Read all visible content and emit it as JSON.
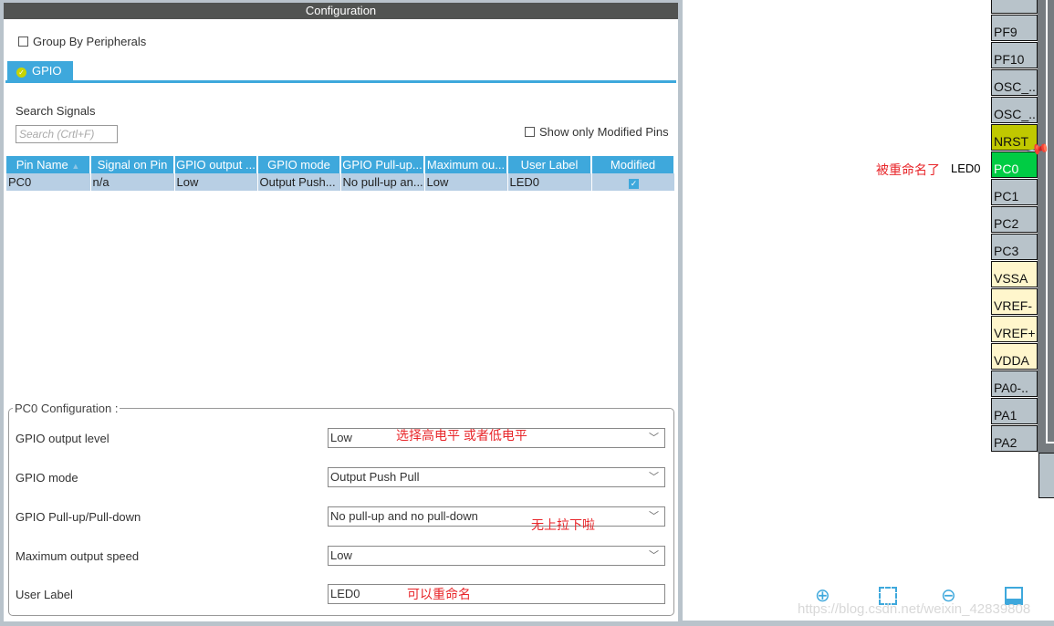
{
  "config": {
    "title": "Configuration",
    "group_by": "Group By Peripherals",
    "tab": "GPIO",
    "search_label": "Search Signals",
    "search_placeholder": "Search (Crtl+F)",
    "show_modified": "Show only Modified Pins"
  },
  "table": {
    "headers": [
      "Pin Name",
      "Signal on Pin",
      "GPIO output ...",
      "GPIO mode",
      "GPIO Pull-up...",
      "Maximum ou...",
      "User Label",
      "Modified"
    ],
    "rows": [
      {
        "pin": "PC0",
        "signal": "n/a",
        "output": "Low",
        "mode": "Output Push...",
        "pull": "No pull-up an...",
        "speed": "Low",
        "label": "LED0",
        "modified": true
      }
    ]
  },
  "pc0": {
    "legend": "PC0 Configuration :",
    "fields": [
      {
        "label": "GPIO output level",
        "value": "Low"
      },
      {
        "label": "GPIO mode",
        "value": "Output Push Pull"
      },
      {
        "label": "GPIO Pull-up/Pull-down",
        "value": "No pull-up and no pull-down"
      },
      {
        "label": "Maximum output speed",
        "value": "Low"
      },
      {
        "label": "User Label",
        "value": "LED0"
      }
    ]
  },
  "annotations": {
    "level": "选择高电平 或者低电平",
    "pull": "无上拉下啦",
    "label": "可以重命名",
    "renamed": "被重命名了",
    "renamed_value": "LED0"
  },
  "pins": [
    {
      "name": "PF9",
      "color": "#b8c3ca"
    },
    {
      "name": "PF10",
      "color": "#b8c3ca"
    },
    {
      "name": "OSC_..",
      "color": "#b8c3ca"
    },
    {
      "name": "OSC_..",
      "color": "#b8c3ca"
    },
    {
      "name": "NRST",
      "color": "#c0c800"
    },
    {
      "name": "PC0",
      "color": "#00cc44"
    },
    {
      "name": "PC1",
      "color": "#b8c3ca"
    },
    {
      "name": "PC2",
      "color": "#b8c3ca"
    },
    {
      "name": "PC3",
      "color": "#b8c3ca"
    },
    {
      "name": "VSSA",
      "color": "#fff6cc"
    },
    {
      "name": "VREF-",
      "color": "#fff6cc"
    },
    {
      "name": "VREF+",
      "color": "#fff6cc"
    },
    {
      "name": "VDDA",
      "color": "#fff6cc"
    },
    {
      "name": "PA0-..",
      "color": "#b8c3ca"
    },
    {
      "name": "PA1",
      "color": "#b8c3ca"
    },
    {
      "name": "PA2",
      "color": "#b8c3ca"
    }
  ],
  "toolbar": [
    "zoom-in",
    "fit",
    "zoom-out",
    "export"
  ],
  "watermark": "https://blog.csdn.net/weixin_42839808"
}
